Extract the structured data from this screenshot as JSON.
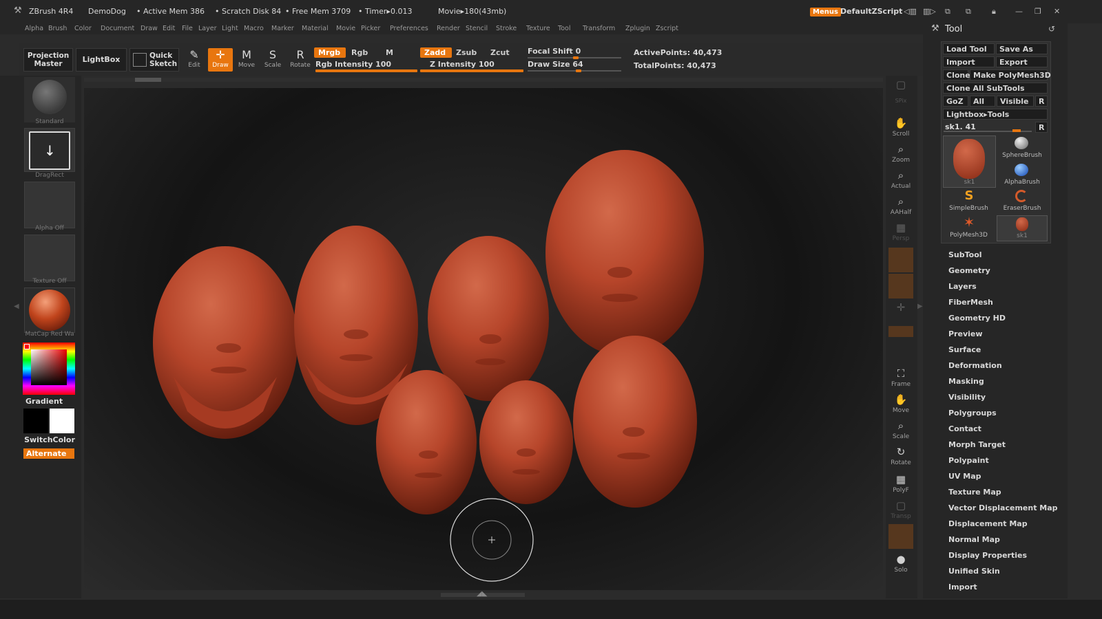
{
  "titlebar": {
    "app": "ZBrush 4R4",
    "project": "DemoDog",
    "active_mem": "• Active Mem 386",
    "scratch_disk": "• Scratch Disk 84",
    "free_mem": "• Free Mem 3709",
    "timer": "• Timer▸0.013",
    "movie": "Movie▸180(43mb)",
    "menus_label": "Menus",
    "script_label": "DefaultZScript"
  },
  "menubar": [
    "Alpha",
    "Brush",
    "Color",
    "Document",
    "Draw",
    "Edit",
    "File",
    "Layer",
    "Light",
    "Macro",
    "Marker",
    "Material",
    "Movie",
    "Picker",
    "Preferences",
    "Render",
    "Stencil",
    "Stroke",
    "Texture",
    "Tool",
    "Transform",
    "Zplugin",
    "Zscript"
  ],
  "toolbar": {
    "projection_master": "Projection Master",
    "lightbox": "LightBox",
    "quick_sketch": "Quick Sketch",
    "edit": "Edit",
    "draw": "Draw",
    "move": "Move",
    "scale": "Scale",
    "rotate": "Rotate",
    "mrgb": "Mrgb",
    "rgb": "Rgb",
    "m": "M",
    "zadd": "Zadd",
    "zsub": "Zsub",
    "zcut": "Zcut",
    "rgb_intensity": "Rgb Intensity 100",
    "z_intensity": "Z Intensity 100",
    "focal_shift": "Focal Shift 0",
    "draw_size": "Draw Size 64",
    "active_points": "ActivePoints: 40,473",
    "total_points": "TotalPoints: 40,473",
    "rgb_intensity_value": 100,
    "z_intensity_value": 100,
    "focal_shift_value": 0,
    "draw_size_value": 64
  },
  "leftshelf": {
    "standard": "Standard",
    "dragrect": "DragRect",
    "alpha_off": "Alpha Off",
    "texture_off": "Texture Off",
    "matcap": "MatCap Red Wa",
    "gradient": "Gradient",
    "switchcolor": "SwitchColor",
    "alternate": "Alternate"
  },
  "rshelf": [
    "",
    "SPix",
    "Scroll",
    "Zoom",
    "Actual",
    "AAHalf",
    "Persp",
    "",
    "",
    "",
    "",
    "Frame",
    "Move",
    "Scale",
    "Rotate",
    "PolyF",
    "Transp",
    "",
    "Solo"
  ],
  "tool_panel": {
    "title": "Tool",
    "load_tool": "Load Tool",
    "save_as": "Save As",
    "import": "Import",
    "export": "Export",
    "clone": "Clone",
    "make_polymesh": "Make PolyMesh3D",
    "clone_all": "Clone  All SubTools",
    "goz": "GoZ",
    "all": "All",
    "visible": "Visible",
    "r": "R",
    "lightbox_tools": "Lightbox▸Tools",
    "current_tool": "sk1. 41",
    "brushes": [
      "sk1",
      "SphereBrush",
      "AlphaBrush",
      "SimpleBrush",
      "EraserBrush",
      "PolyMesh3D",
      "sk1"
    ],
    "sections": [
      "SubTool",
      "Geometry",
      "Layers",
      "FiberMesh",
      "Geometry HD",
      "Preview",
      "Surface",
      "Deformation",
      "Masking",
      "Visibility",
      "Polygroups",
      "Contact",
      "Morph Target",
      "Polypaint",
      "UV Map",
      "Texture Map",
      "Vector Displacement Map",
      "Displacement Map",
      "Normal Map",
      "Display Properties",
      "Unified Skin",
      "Import"
    ]
  },
  "colors": {
    "accent": "#e8760f",
    "clay": "#b6452a",
    "panel": "#262626"
  }
}
